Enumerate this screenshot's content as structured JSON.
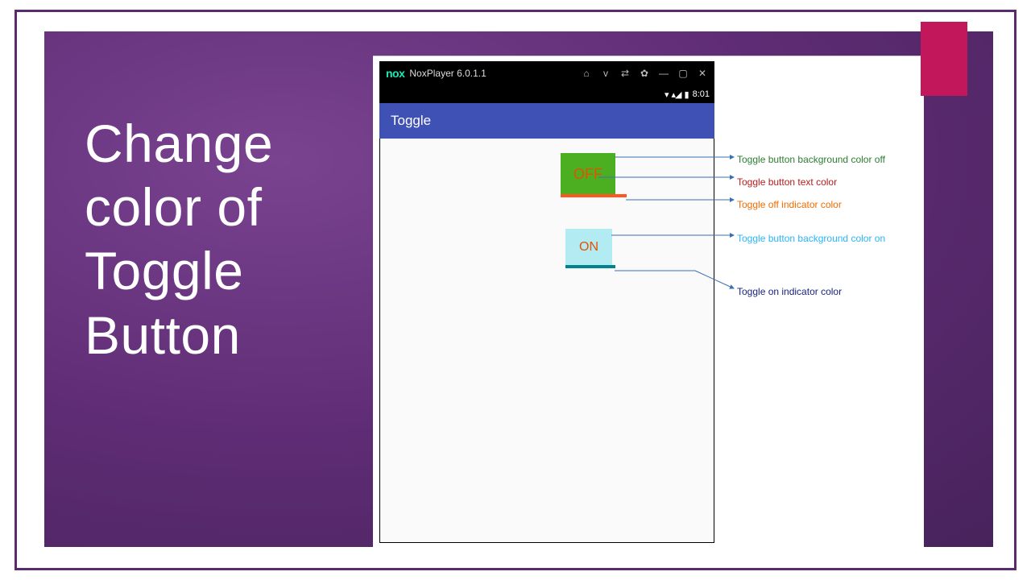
{
  "slide": {
    "title_line1": "Change",
    "title_line2": "color of",
    "title_line3": "Toggle",
    "title_line4": "Button"
  },
  "emulator": {
    "logo": "nox",
    "title": "NoxPlayer 6.0.1.1",
    "icons": {
      "home": "⌂",
      "down": "v",
      "shake": "⇄",
      "settings": "✿",
      "minimize": "—",
      "maximize": "▢",
      "close": "✕"
    }
  },
  "status": {
    "wifi": "▾",
    "signal": "▴◢",
    "battery": "▮",
    "time": "8:01"
  },
  "app": {
    "header": "Toggle",
    "off_label": "OFF",
    "on_label": "ON"
  },
  "annotations": {
    "bg_off": "Toggle button background color off",
    "text_color": "Toggle button text color",
    "off_indicator": "Toggle off indicator color",
    "bg_on": "Toggle button background color on",
    "on_indicator": "Toggle on indicator color"
  },
  "colors": {
    "accent_pink": "#c2185b",
    "slide_bg": "#5e2c74",
    "app_bar": "#3f51b5",
    "off_bg": "#4caf22",
    "on_bg": "#b2ebf2",
    "off_indicator": "#ff5722",
    "on_indicator": "#00838f",
    "toggle_text": "#e65100"
  }
}
